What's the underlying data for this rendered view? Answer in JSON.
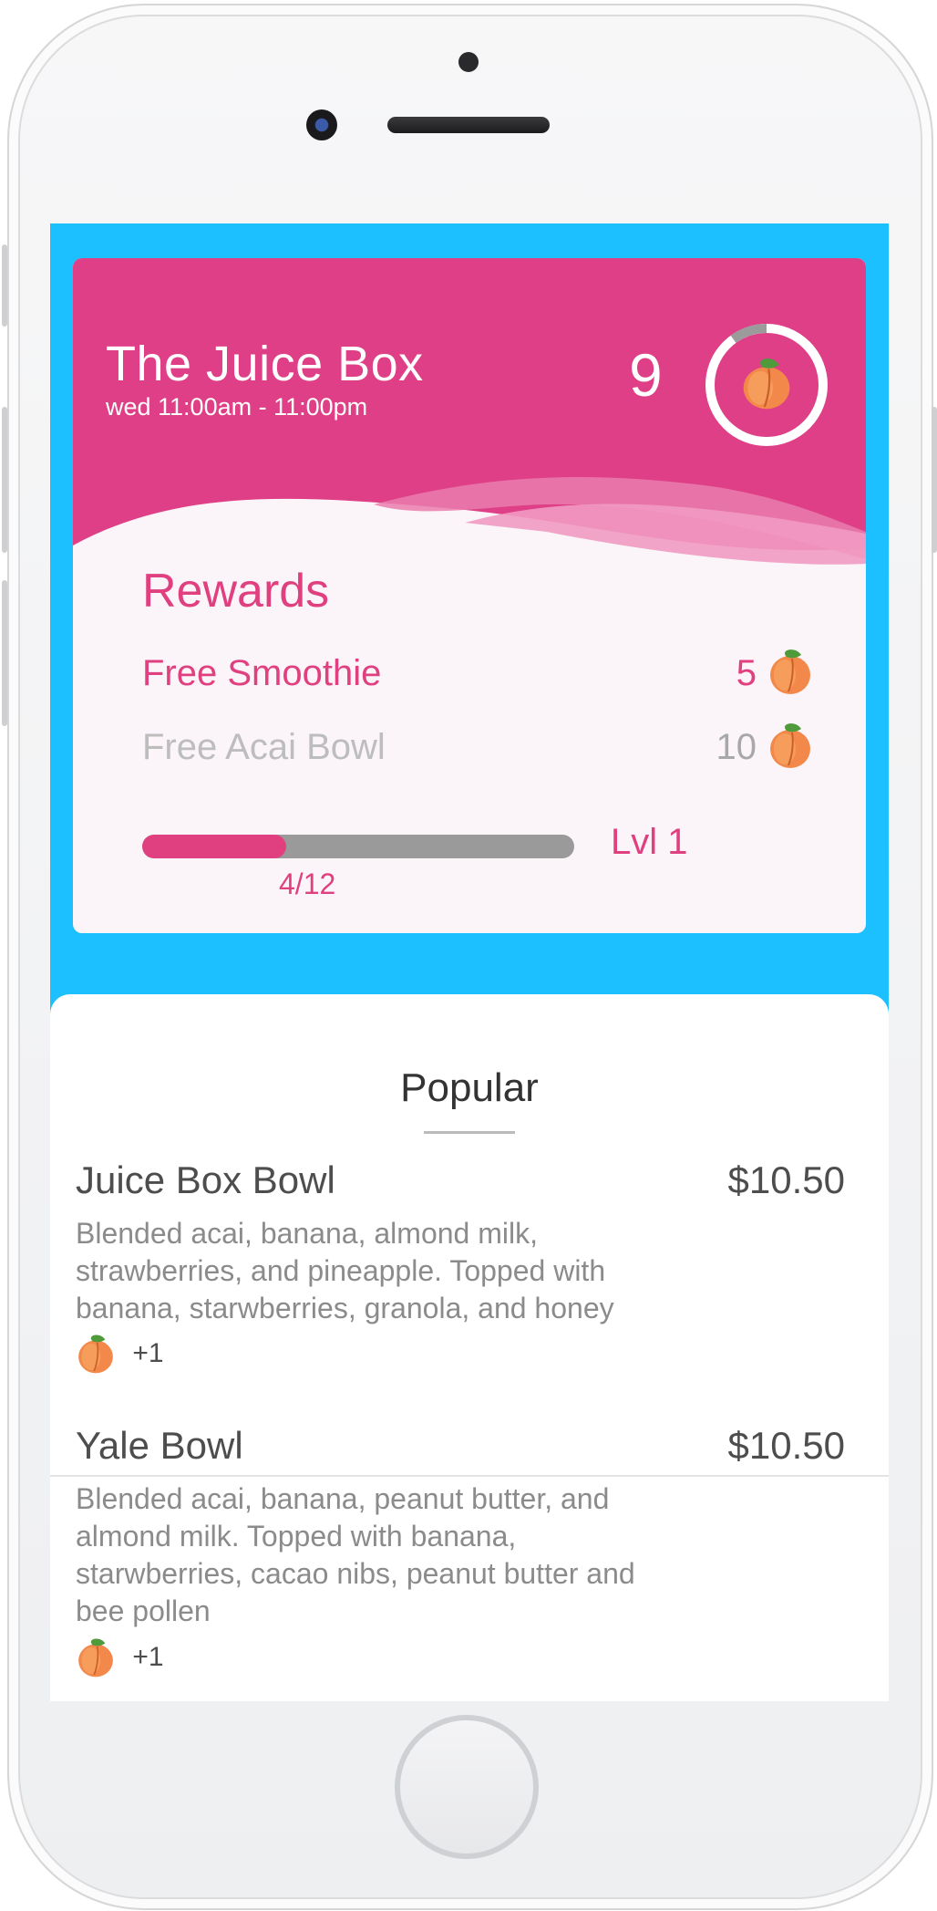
{
  "shop": {
    "name": "The Juice Box",
    "hours": "wed 11:00am - 11:00pm",
    "points": "9",
    "points_progress": 0.1
  },
  "rewards": {
    "heading": "Rewards",
    "items": [
      {
        "label": "Free Smoothie",
        "cost": "5",
        "available": true
      },
      {
        "label": "Free Acai Bowl",
        "cost": "10",
        "available": false
      }
    ],
    "progress_text": "4/12",
    "progress_fraction": 0.333,
    "level": "Lvl 1"
  },
  "menu": {
    "heading": "Popular",
    "items": [
      {
        "name": "Juice Box Bowl",
        "price": "$10.50",
        "description": "Blended acai, banana, almond milk, strawberries, and pineapple. Topped with banana, starwberries, granola, and honey",
        "points": "+1"
      },
      {
        "name": "Yale Bowl",
        "price": "$10.50",
        "description": "Blended acai, banana, peanut butter, and almond milk. Topped with banana, starwberries, cacao nibs, peanut butter and bee pollen",
        "points": "+1"
      }
    ]
  },
  "colors": {
    "brand_pink": "#e0407f",
    "screen_blue": "#1dc0ff",
    "muted_gray": "#9a9a9a"
  },
  "icons": {
    "points": "peach-icon"
  }
}
